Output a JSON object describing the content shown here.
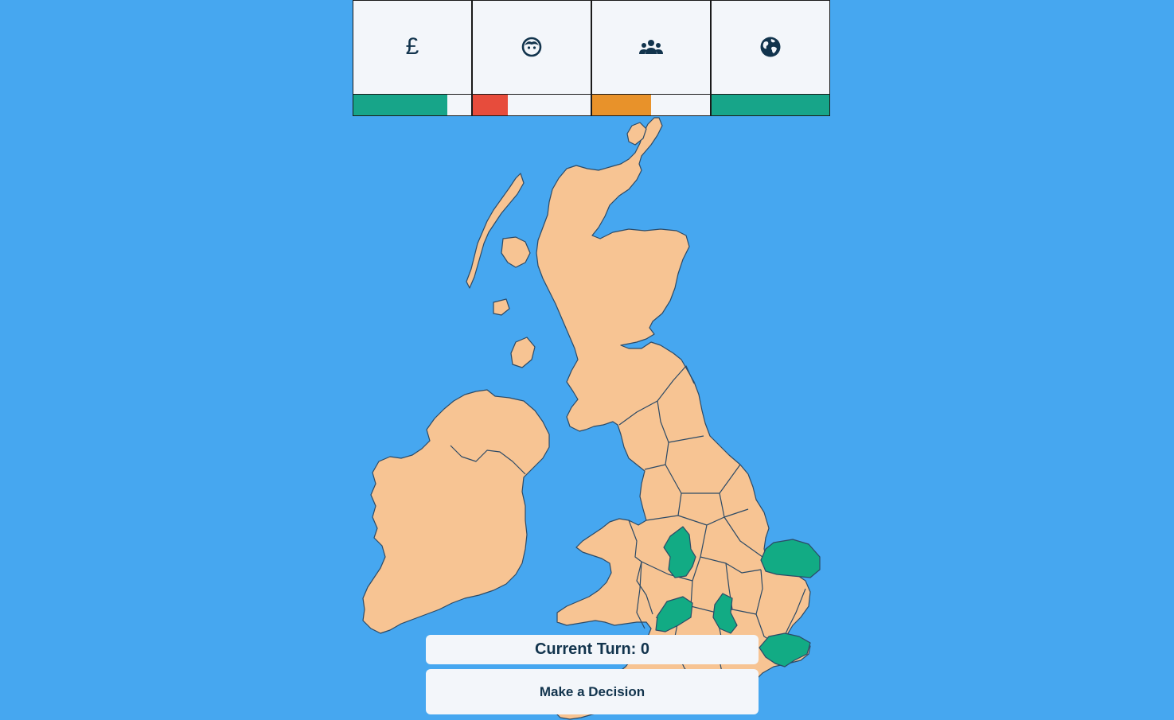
{
  "stats": [
    {
      "key": "economy",
      "icon": "pound-icon",
      "symbol": "£",
      "level": 0.8,
      "color": "#17a589"
    },
    {
      "key": "happiness",
      "icon": "face-icon",
      "level": 0.3,
      "color": "#e74c3c"
    },
    {
      "key": "population",
      "icon": "people-icon",
      "level": 0.5,
      "color": "#e8922a"
    },
    {
      "key": "environment",
      "icon": "globe-icon",
      "level": 1.0,
      "color": "#17a589"
    }
  ],
  "map": {
    "land_color": "#f7c493",
    "highlight_color": "#12ab84",
    "sea_color": "#46a7f0",
    "highlighted_regions": [
      "staffordshire",
      "herefordshire-worcestershire",
      "oxfordshire-bucks",
      "norfolk",
      "kent"
    ]
  },
  "turn": {
    "label": "Current Turn: 0"
  },
  "decision": {
    "label": "Make a Decision"
  }
}
